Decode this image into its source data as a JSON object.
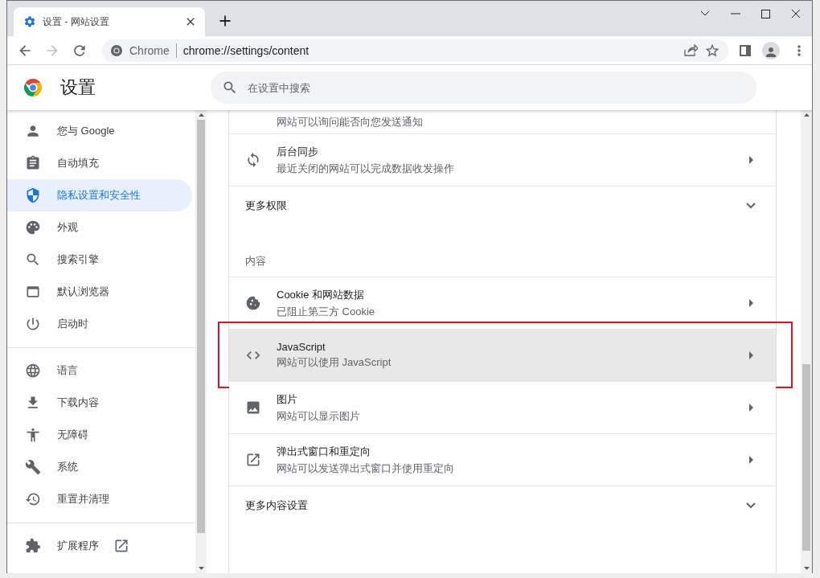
{
  "tab": {
    "title": "设置 - 网站设置"
  },
  "address": {
    "site_label": "Chrome",
    "url": "chrome://settings/content"
  },
  "header": {
    "title": "设置",
    "search": {
      "placeholder": "在设置中搜索"
    }
  },
  "sidebar": {
    "groups": [
      [
        {
          "label": "您与 Google",
          "selected": false
        },
        {
          "label": "自动填充",
          "selected": false
        },
        {
          "label": "隐私设置和安全性",
          "selected": true
        },
        {
          "label": "外观",
          "selected": false
        },
        {
          "label": "搜索引擎",
          "selected": false
        },
        {
          "label": "默认浏览器",
          "selected": false
        },
        {
          "label": "启动时",
          "selected": false
        }
      ],
      [
        {
          "label": "语言",
          "selected": false
        },
        {
          "label": "下载内容",
          "selected": false
        },
        {
          "label": "无障碍",
          "selected": false
        },
        {
          "label": "系统",
          "selected": false
        },
        {
          "label": "重置并清理",
          "selected": false
        }
      ],
      [
        {
          "label": "扩展程序",
          "selected": false,
          "external": true
        }
      ]
    ]
  },
  "content": {
    "rows": [
      {
        "kind": "partial",
        "subtitle": "网站可以询问能否向您发送通知"
      },
      {
        "kind": "link",
        "title": "后台同步",
        "subtitle": "最近关闭的网站可以完成数据收发操作",
        "highlighted": false,
        "annotated": false
      },
      {
        "kind": "expand",
        "title": "更多权限",
        "expanded": false
      },
      {
        "kind": "heading",
        "title": "内容"
      },
      {
        "kind": "link",
        "title": "Cookie 和网站数据",
        "subtitle": "已阻止第三方 Cookie",
        "highlighted": false,
        "annotated": false
      },
      {
        "kind": "link",
        "title": "JavaScript",
        "subtitle": "网站可以使用 JavaScript",
        "highlighted": true,
        "annotated": true
      },
      {
        "kind": "link",
        "title": "图片",
        "subtitle": "网站可以显示图片",
        "highlighted": false,
        "annotated": false
      },
      {
        "kind": "link",
        "title": "弹出式窗口和重定向",
        "subtitle": "网站可以发送弹出式窗口并使用重定向",
        "highlighted": false,
        "annotated": false
      },
      {
        "kind": "expand",
        "title": "更多内容设置",
        "expanded": false
      }
    ]
  }
}
